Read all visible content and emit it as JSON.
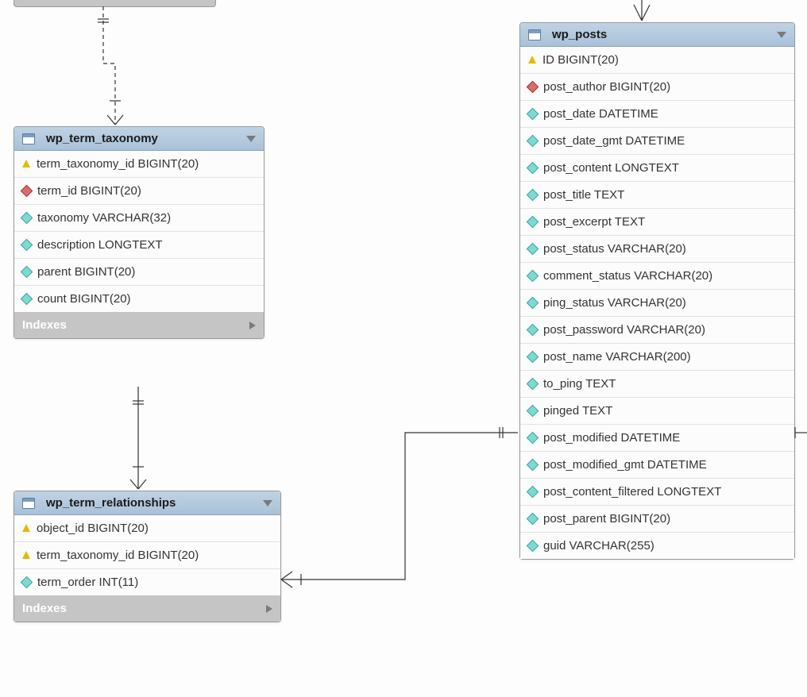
{
  "tables": {
    "wp_term_taxonomy": {
      "title": "wp_term_taxonomy",
      "columns": [
        {
          "icon": "key",
          "label": "term_taxonomy_id BIGINT(20)"
        },
        {
          "icon": "red",
          "label": "term_id BIGINT(20)"
        },
        {
          "icon": "cyan",
          "label": "taxonomy VARCHAR(32)"
        },
        {
          "icon": "cyan",
          "label": "description LONGTEXT"
        },
        {
          "icon": "cyan",
          "label": "parent BIGINT(20)"
        },
        {
          "icon": "cyan",
          "label": "count BIGINT(20)"
        }
      ],
      "footer": "Indexes"
    },
    "wp_term_relationships": {
      "title": "wp_term_relationships",
      "columns": [
        {
          "icon": "key",
          "label": "object_id BIGINT(20)"
        },
        {
          "icon": "key",
          "label": "term_taxonomy_id BIGINT(20)"
        },
        {
          "icon": "cyan",
          "label": "term_order INT(11)"
        }
      ],
      "footer": "Indexes"
    },
    "wp_posts": {
      "title": "wp_posts",
      "columns": [
        {
          "icon": "key",
          "label": "ID BIGINT(20)"
        },
        {
          "icon": "red",
          "label": "post_author BIGINT(20)"
        },
        {
          "icon": "cyan",
          "label": "post_date DATETIME"
        },
        {
          "icon": "cyan",
          "label": "post_date_gmt DATETIME"
        },
        {
          "icon": "cyan",
          "label": "post_content LONGTEXT"
        },
        {
          "icon": "cyan",
          "label": "post_title TEXT"
        },
        {
          "icon": "cyan",
          "label": "post_excerpt TEXT"
        },
        {
          "icon": "cyan",
          "label": "post_status VARCHAR(20)"
        },
        {
          "icon": "cyan",
          "label": "comment_status VARCHAR(20)"
        },
        {
          "icon": "cyan",
          "label": "ping_status VARCHAR(20)"
        },
        {
          "icon": "cyan",
          "label": "post_password VARCHAR(20)"
        },
        {
          "icon": "cyan",
          "label": "post_name VARCHAR(200)"
        },
        {
          "icon": "cyan",
          "label": "to_ping TEXT"
        },
        {
          "icon": "cyan",
          "label": "pinged TEXT"
        },
        {
          "icon": "cyan",
          "label": "post_modified DATETIME"
        },
        {
          "icon": "cyan",
          "label": "post_modified_gmt DATETIME"
        },
        {
          "icon": "cyan",
          "label": "post_content_filtered LONGTEXT"
        },
        {
          "icon": "cyan",
          "label": "post_parent BIGINT(20)"
        },
        {
          "icon": "cyan",
          "label": "guid VARCHAR(255)"
        }
      ]
    }
  }
}
